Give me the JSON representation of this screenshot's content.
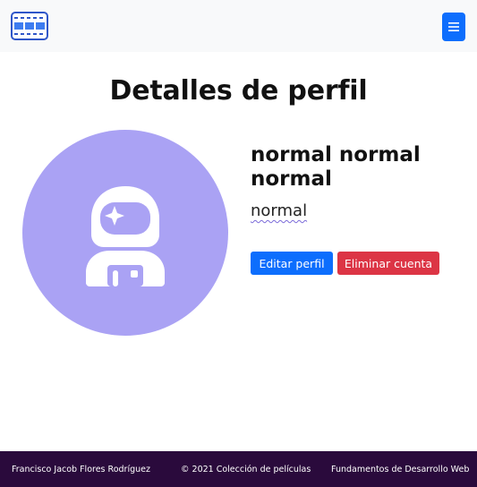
{
  "navbar": {
    "logo_icon": "film-strip-icon",
    "menu_icon": "hamburger-menu-icon",
    "accent_color": "#0d6efd"
  },
  "page": {
    "title": "Detalles de perfil"
  },
  "profile": {
    "avatar_icon": "astronaut-icon",
    "avatar_bg": "#aaa2f4",
    "full_name": "normal normal normal",
    "username": "normal"
  },
  "actions": {
    "edit_label": "Editar perfil",
    "delete_label": "Eliminar cuenta",
    "edit_color": "#0d6efd",
    "delete_color": "#dc3545"
  },
  "footer": {
    "author": "Francisco Jacob Flores Rodríguez",
    "copyright": "© 2021 Colección de películas",
    "course": "Fundamentos de Desarrollo Web",
    "bg_color": "#2a0a3c"
  }
}
